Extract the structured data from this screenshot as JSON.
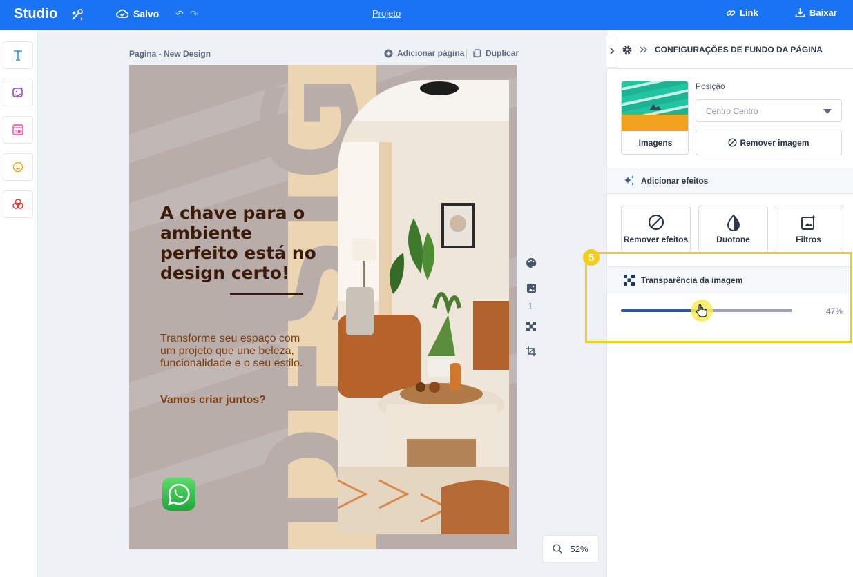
{
  "topbar": {
    "brand": "Studio",
    "saved_label": "Salvo",
    "project_label": "Projeto",
    "link_label": "Link",
    "download_label": "Baixar",
    "background_color": "#1a73f2"
  },
  "left_tools": [
    {
      "icon": "text-icon",
      "color": "#1aa7d8"
    },
    {
      "icon": "image-edit-icon",
      "color": "#8a3fd1"
    },
    {
      "icon": "gif-icon",
      "color": "#e94aa0"
    },
    {
      "icon": "emoji-icon",
      "color": "#f2a51a"
    },
    {
      "icon": "shapes-icon",
      "color": "#e5322f"
    }
  ],
  "canvas": {
    "page_title": "Pagina - New Design",
    "add_page_label": "Adicionar página",
    "duplicate_label": "Duplicar",
    "page_number": "1",
    "zoom": "52%"
  },
  "design": {
    "vertical_word": "DESIGN",
    "headline": "A chave para o ambiente perfeito está no design certo!",
    "subtext": "Transforme seu espaço com um projeto que une beleza, funcionalidade e o seu estilo.",
    "cta": "Vamos criar juntos?",
    "background_color": "#b9adaa",
    "accent_color": "#ecd5b2",
    "headline_color": "#3a1a08",
    "text_color": "#7a3f12"
  },
  "panel": {
    "title": "CONFIGURAÇÕES DE FUNDO DA PÁGINA",
    "images_label": "Imagens",
    "position_label": "Posição",
    "position_value": "Centro Centro",
    "remove_image_label": "Remover imagem",
    "add_effects_label": "Adicionar efeitos",
    "effects": [
      {
        "label": "Remover efeitos",
        "icon": "ban-icon"
      },
      {
        "label": "Duotone",
        "icon": "duotone-icon"
      },
      {
        "label": "Filtros",
        "icon": "filters-icon"
      }
    ],
    "transparency_label": "Transparência da imagem",
    "transparency_value": 47,
    "transparency_display": "47%",
    "step_badge": "5",
    "highlight_color": "#f2cd19"
  }
}
